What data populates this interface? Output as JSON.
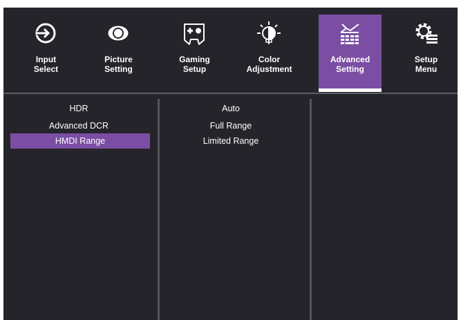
{
  "tabs": [
    {
      "label": "Input\nSelect",
      "icon": "input-select-icon"
    },
    {
      "label": "Picture\nSetting",
      "icon": "eye-icon"
    },
    {
      "label": "Gaming\nSetup",
      "icon": "gamepad-icon"
    },
    {
      "label": "Color\nAdjustment",
      "icon": "color-bulb-icon"
    },
    {
      "label": "Advanced\nSetting",
      "icon": "advanced-setting-icon",
      "active": true
    },
    {
      "label": "Setup\nMenu",
      "icon": "gear-menu-icon"
    }
  ],
  "col1": {
    "items": [
      "HDR",
      "Advanced DCR",
      "HMDI Range"
    ],
    "selected": "HMDI Range"
  },
  "col2": {
    "items": [
      "Auto",
      "Full Range",
      "Limited Range"
    ]
  },
  "colors": {
    "background": "#24242a",
    "accent": "#7b4ea3",
    "text": "#ffffff",
    "divider": "#55555c"
  }
}
